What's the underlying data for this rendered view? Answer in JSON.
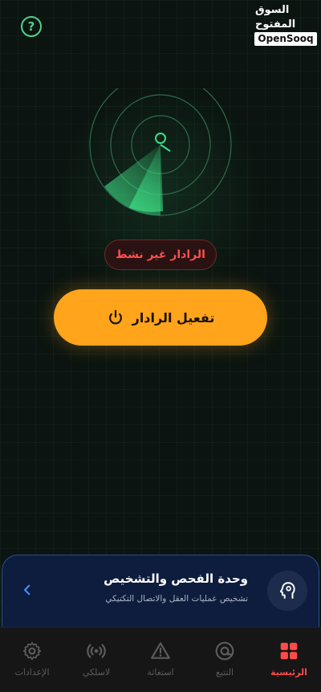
{
  "header": {
    "help_icon": "question-circle-icon",
    "help_label": "?",
    "logo_arabic": "السوق المفتوح",
    "logo_english": "OpenSooq"
  },
  "radar": {
    "status_label": "الرادار غير نشط",
    "activate_label": "تفعيل الرادار",
    "accent_color": "#3ddc84",
    "status_color": "#ff4f4f",
    "button_color": "#ffa41b"
  },
  "diagnostics": {
    "title": "وحدة الفحص والتشخيص",
    "subtitle": "تشخيص عمليات العقل والاتصال التكتيكي",
    "icon": "brain-head-icon",
    "accent_color": "#2c4d8c"
  },
  "nav": {
    "items": [
      {
        "label": "الرئيسية",
        "icon": "grid-icon"
      },
      {
        "label": "التتبع",
        "icon": "target-icon"
      },
      {
        "label": "استغاثة",
        "icon": "warning-icon"
      },
      {
        "label": "لاسلكي",
        "icon": "radio-icon"
      },
      {
        "label": "الإعدادات",
        "icon": "gear-icon"
      }
    ],
    "active_color": "#ff4a4a"
  }
}
